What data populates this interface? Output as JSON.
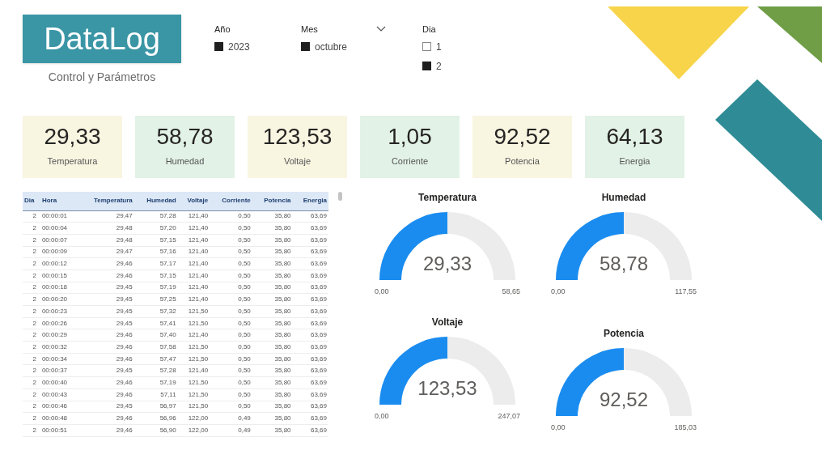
{
  "logo": {
    "title": "DataLog",
    "subtitle": "Control y Parámetros"
  },
  "slicers": [
    {
      "label": "Año",
      "options": [
        {
          "label": "2023",
          "selected": true
        }
      ]
    },
    {
      "label": "Mes",
      "dropdown": true,
      "options": [
        {
          "label": "octubre",
          "selected": true
        }
      ]
    },
    {
      "label": "Dia",
      "options": [
        {
          "label": "1",
          "selected": false
        },
        {
          "label": "2",
          "selected": true
        }
      ]
    }
  ],
  "cards": [
    {
      "value": "29,33",
      "label": "Temperatura"
    },
    {
      "value": "58,78",
      "label": "Humedad"
    },
    {
      "value": "123,53",
      "label": "Voltaje"
    },
    {
      "value": "1,05",
      "label": "Corriente"
    },
    {
      "value": "92,52",
      "label": "Potencia"
    },
    {
      "value": "64,13",
      "label": "Energia"
    }
  ],
  "table": {
    "columns": [
      "Dia",
      "Hora",
      "Temperatura",
      "Humedad",
      "Voltaje",
      "Corriente",
      "Potencia",
      "Energia"
    ],
    "rows": [
      [
        "2",
        "00:00:01",
        "29,47",
        "57,28",
        "121,40",
        "0,50",
        "35,80",
        "63,69"
      ],
      [
        "2",
        "00:00:04",
        "29,48",
        "57,20",
        "121,40",
        "0,50",
        "35,80",
        "63,69"
      ],
      [
        "2",
        "00:00:07",
        "29,48",
        "57,15",
        "121,40",
        "0,50",
        "35,80",
        "63,69"
      ],
      [
        "2",
        "00:00:09",
        "29,47",
        "57,16",
        "121,40",
        "0,50",
        "35,80",
        "63,69"
      ],
      [
        "2",
        "00:00:12",
        "29,46",
        "57,17",
        "121,40",
        "0,50",
        "35,80",
        "63,69"
      ],
      [
        "2",
        "00:00:15",
        "29,46",
        "57,15",
        "121,40",
        "0,50",
        "35,80",
        "63,69"
      ],
      [
        "2",
        "00:00:18",
        "29,45",
        "57,19",
        "121,40",
        "0,50",
        "35,80",
        "63,69"
      ],
      [
        "2",
        "00:00:20",
        "29,45",
        "57,25",
        "121,40",
        "0,50",
        "35,80",
        "63,69"
      ],
      [
        "2",
        "00:00:23",
        "29,45",
        "57,32",
        "121,50",
        "0,50",
        "35,80",
        "63,69"
      ],
      [
        "2",
        "00:00:26",
        "29,45",
        "57,41",
        "121,50",
        "0,50",
        "35,80",
        "63,69"
      ],
      [
        "2",
        "00:00:29",
        "29,46",
        "57,40",
        "121,40",
        "0,50",
        "35,80",
        "63,69"
      ],
      [
        "2",
        "00:00:32",
        "29,46",
        "57,58",
        "121,50",
        "0,50",
        "35,80",
        "63,69"
      ],
      [
        "2",
        "00:00:34",
        "29,46",
        "57,47",
        "121,50",
        "0,50",
        "35,80",
        "63,69"
      ],
      [
        "2",
        "00:00:37",
        "29,45",
        "57,28",
        "121,40",
        "0,50",
        "35,80",
        "63,69"
      ],
      [
        "2",
        "00:00:40",
        "29,46",
        "57,19",
        "121,50",
        "0,50",
        "35,80",
        "63,69"
      ],
      [
        "2",
        "00:00:43",
        "29,46",
        "57,11",
        "121,50",
        "0,50",
        "35,80",
        "63,69"
      ],
      [
        "2",
        "00:00:46",
        "29,45",
        "56,97",
        "121,50",
        "0,50",
        "35,80",
        "63,69"
      ],
      [
        "2",
        "00:00:48",
        "29,46",
        "56,96",
        "122,00",
        "0,49",
        "35,80",
        "63,69"
      ],
      [
        "2",
        "00:00:51",
        "29,46",
        "56,90",
        "122,00",
        "0,49",
        "35,80",
        "63,69"
      ]
    ]
  },
  "gauges": [
    {
      "title": "Temperatura",
      "value": "29,33",
      "min": "0,00",
      "max": "58,65",
      "level": 0.5
    },
    {
      "title": "Humedad",
      "value": "58,78",
      "min": "0,00",
      "max": "117,55",
      "level": 0.5
    },
    {
      "title": "Voltaje",
      "value": "123,53",
      "min": "0,00",
      "max": "247,07",
      "level": 0.5
    },
    {
      "title": "Potencia",
      "value": "92,52",
      "min": "0,00",
      "max": "185,03",
      "level": 0.5
    }
  ]
}
